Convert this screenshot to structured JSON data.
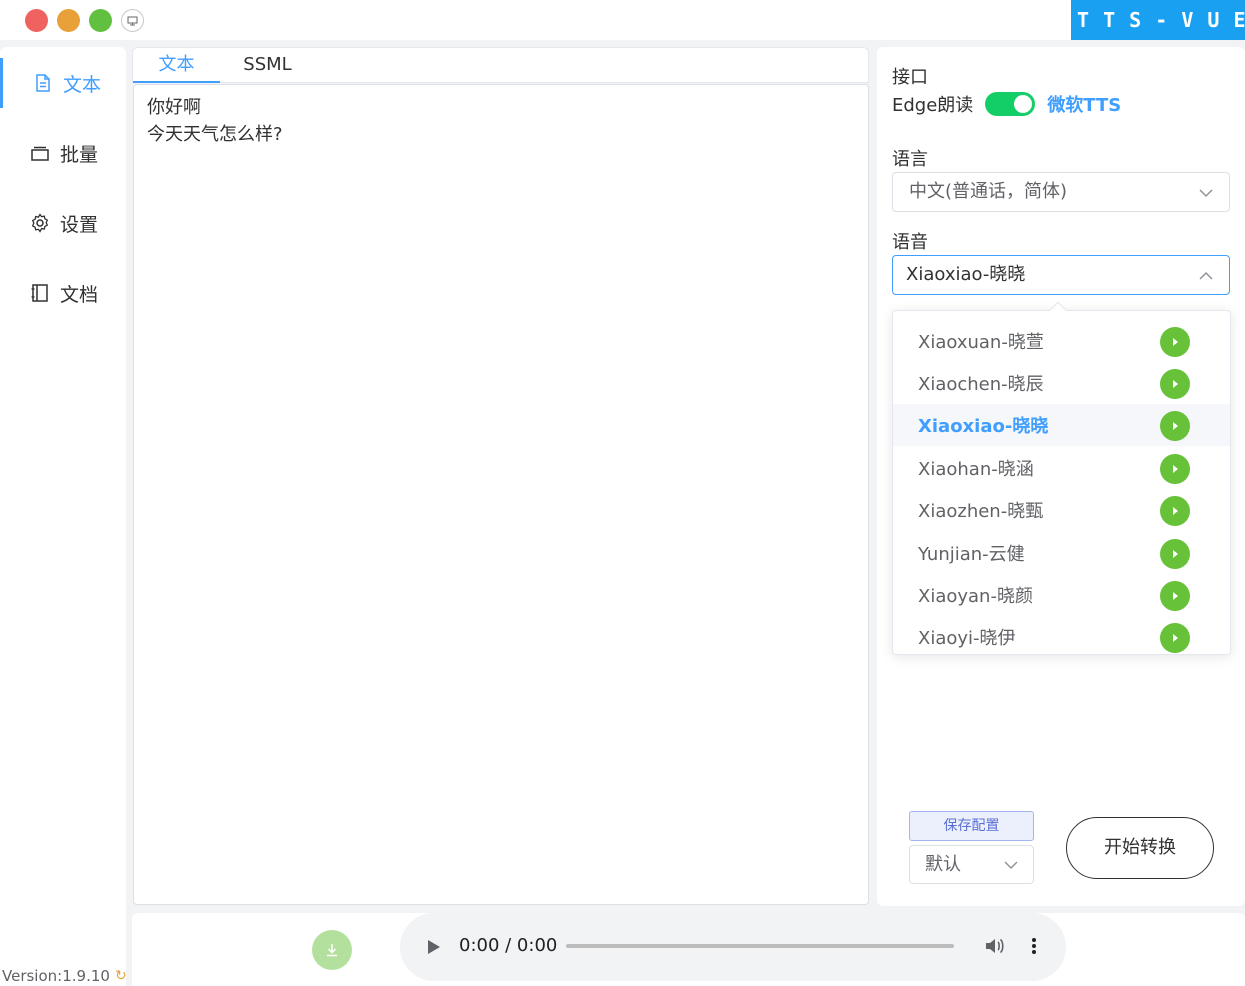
{
  "window": {
    "brand": "T T S - V U E"
  },
  "sidebar": {
    "items": [
      {
        "label": "文本",
        "icon": "document-icon",
        "active": true
      },
      {
        "label": "批量",
        "icon": "layers-icon",
        "active": false
      },
      {
        "label": "设置",
        "icon": "gear-icon",
        "active": false
      },
      {
        "label": "文档",
        "icon": "notebook-icon",
        "active": false
      }
    ],
    "version": "Version:1.9.10"
  },
  "editor": {
    "tabs": [
      "文本",
      "SSML"
    ],
    "active_tab": "文本",
    "text": "你好啊\n今天天气怎么样?"
  },
  "options": {
    "interface_label": "接口",
    "switch_off_label": "Edge朗读",
    "switch_on_label": "微软TTS",
    "switch_state": "on",
    "language_label": "语言",
    "language_value": "中文(普通话，简体)",
    "voice_label": "语音",
    "voice_value": "Xiaoxiao-晓晓",
    "voices": [
      "Xiaoxuan-晓萱",
      "Xiaochen-晓辰",
      "Xiaoxiao-晓晓",
      "Xiaohan-晓涵",
      "Xiaozhen-晓甄",
      "Yunjian-云健",
      "Xiaoyan-晓颜",
      "Xiaoyi-晓伊"
    ],
    "selected_voice_index": 2,
    "save_config_label": "保存配置",
    "preset_value": "默认",
    "convert_label": "开始转换"
  },
  "player": {
    "time": "0:00 / 0:00"
  },
  "colors": {
    "accent": "#409eff",
    "brand": "#1aa0f0",
    "switch_on": "#13ce66",
    "play_green": "#67c23a"
  }
}
